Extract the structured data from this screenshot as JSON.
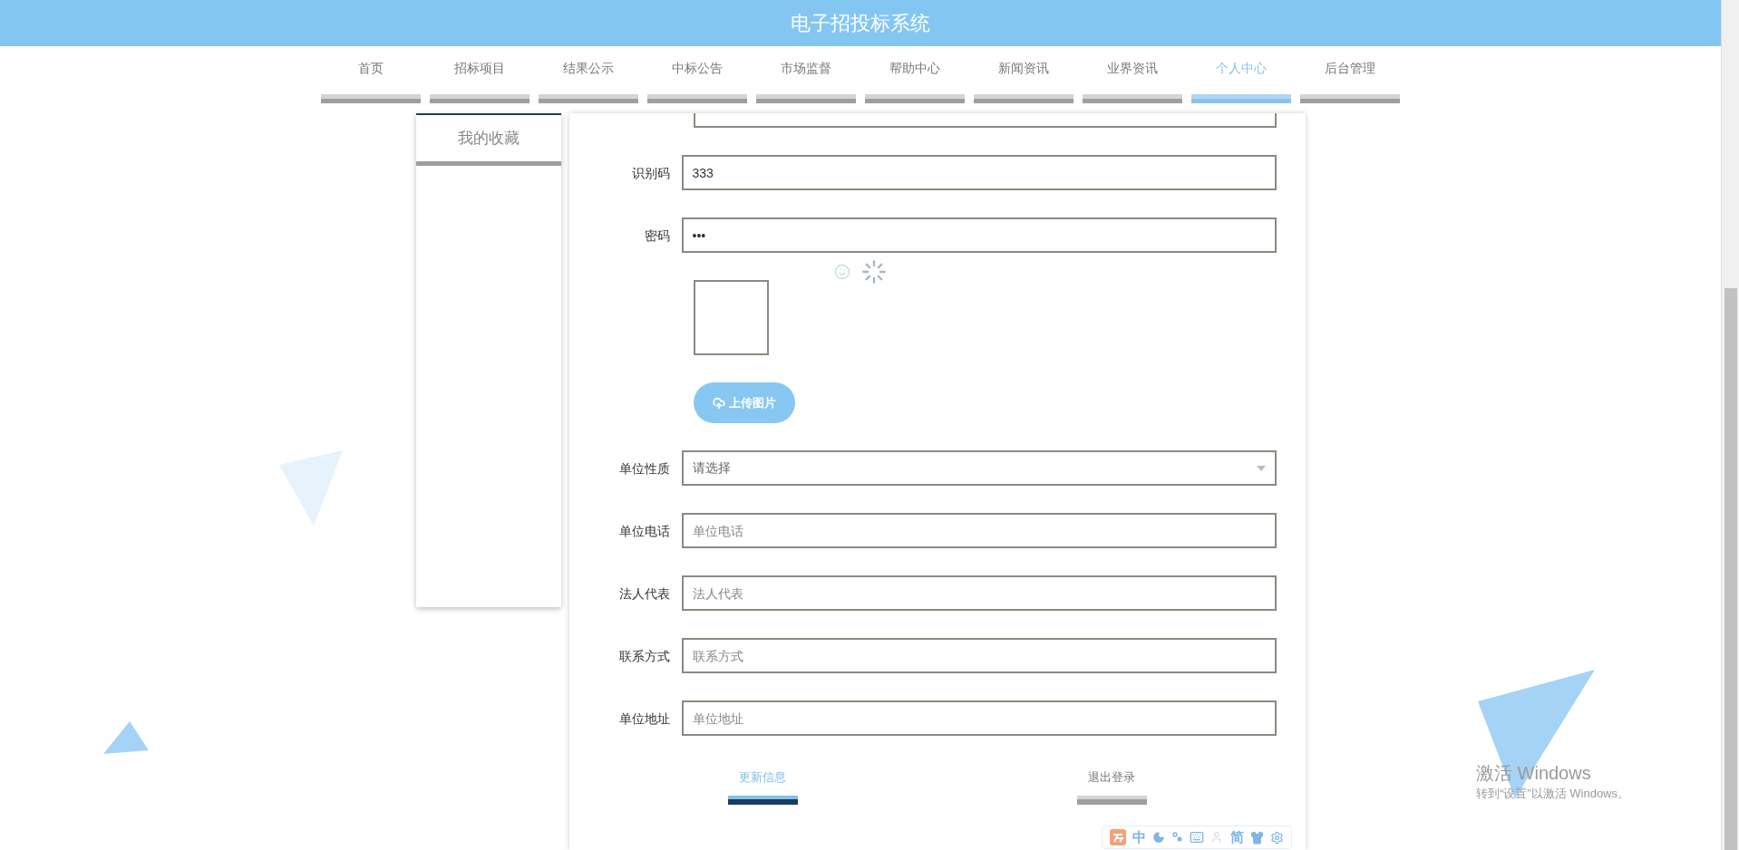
{
  "header": {
    "title": "电子招投标系统"
  },
  "nav": [
    {
      "label": "首页",
      "selected": false
    },
    {
      "label": "招标项目",
      "selected": false
    },
    {
      "label": "结果公示",
      "selected": false
    },
    {
      "label": "中标公告",
      "selected": false
    },
    {
      "label": "市场监督",
      "selected": false
    },
    {
      "label": "帮助中心",
      "selected": false
    },
    {
      "label": "新闻资讯",
      "selected": false
    },
    {
      "label": "业界资讯",
      "selected": false
    },
    {
      "label": "个人中心",
      "selected": true
    },
    {
      "label": "后台管理",
      "selected": false
    }
  ],
  "sidebar": {
    "items": [
      {
        "label": "我的收藏"
      }
    ]
  },
  "form": {
    "rows": [
      {
        "kind": "cut"
      },
      {
        "kind": "text",
        "label": "识别码",
        "value": "333"
      },
      {
        "kind": "text",
        "label": "密码",
        "value": "•••"
      },
      {
        "kind": "image"
      },
      {
        "kind": "upload",
        "label": "上传图片"
      },
      {
        "kind": "select",
        "label": "单位性质",
        "value": "请选择"
      },
      {
        "kind": "text",
        "label": "单位电话",
        "placeholder": "单位电话"
      },
      {
        "kind": "text",
        "label": "法人代表",
        "placeholder": "法人代表"
      },
      {
        "kind": "text",
        "label": "联系方式",
        "placeholder": "联系方式"
      },
      {
        "kind": "text",
        "label": "单位地址",
        "placeholder": "单位地址"
      }
    ],
    "buttons": [
      {
        "label": "更新信息",
        "selected": true
      },
      {
        "label": "退出登录",
        "selected": false
      }
    ]
  },
  "windows_notice": {
    "title": "激活 Windows",
    "subtitle": "转到“设置”以激活 Windows。"
  },
  "ime_toolbar": {
    "mode": "中",
    "charset": "简"
  }
}
